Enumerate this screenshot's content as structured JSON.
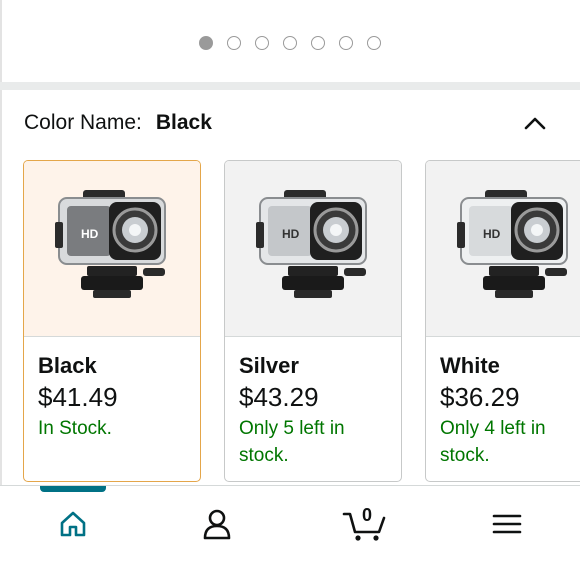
{
  "carousel": {
    "dot_count": 7,
    "active_index": 0
  },
  "variation": {
    "label": "Color Name:",
    "selected_value": "Black"
  },
  "swatches": [
    {
      "name": "Black",
      "price": "$41.49",
      "stock_line1": "In Stock.",
      "stock_line2": "",
      "selected": true
    },
    {
      "name": "Silver",
      "price": "$43.29",
      "stock_line1": "Only 5 left in",
      "stock_line2": "stock.",
      "selected": false
    },
    {
      "name": "White",
      "price": "$36.29",
      "stock_line1": "Only 4 left in",
      "stock_line2": "stock.",
      "selected": false
    }
  ],
  "bottom_nav": {
    "items": [
      "home-icon",
      "account-icon",
      "cart-icon",
      "menu-icon"
    ],
    "active": "home",
    "cart_count": "0"
  },
  "colors": {
    "accent": "#007185",
    "selected_border": "#e4a64a",
    "in_stock_green": "#007600"
  }
}
